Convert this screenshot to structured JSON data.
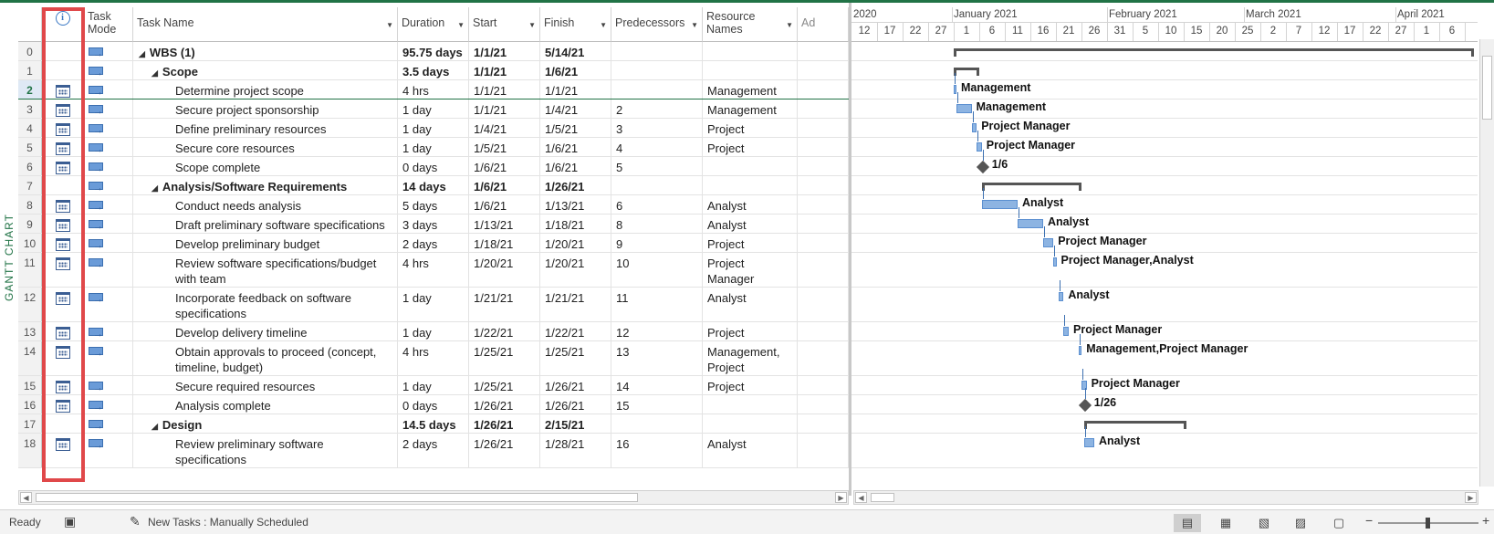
{
  "view_label": "GANTT CHART",
  "columns": {
    "info_icon": "info-icon",
    "task_mode": "Task\nMode",
    "task_name": "Task Name",
    "duration": "Duration",
    "start": "Start",
    "finish": "Finish",
    "predecessors": "Predecessors",
    "resource_names": "Resource\nNames",
    "add": "Ad"
  },
  "rows": [
    {
      "id": "0",
      "indent": 0,
      "summary": true,
      "name": "WBS (1)",
      "duration": "95.75 days",
      "start": "1/1/21",
      "finish": "5/14/21",
      "pred": "",
      "res": "",
      "cal": false
    },
    {
      "id": "1",
      "indent": 1,
      "summary": true,
      "name": "Scope",
      "duration": "3.5 days",
      "start": "1/1/21",
      "finish": "1/6/21",
      "pred": "",
      "res": "",
      "cal": false
    },
    {
      "id": "2",
      "indent": 2,
      "summary": false,
      "name": "Determine project scope",
      "duration": "4 hrs",
      "start": "1/1/21",
      "finish": "1/1/21",
      "pred": "",
      "res": "Management",
      "cal": true,
      "selected": true
    },
    {
      "id": "3",
      "indent": 2,
      "summary": false,
      "name": "Secure project sponsorship",
      "duration": "1 day",
      "start": "1/1/21",
      "finish": "1/4/21",
      "pred": "2",
      "res": "Management",
      "cal": true
    },
    {
      "id": "4",
      "indent": 2,
      "summary": false,
      "name": "Define preliminary resources",
      "duration": "1 day",
      "start": "1/4/21",
      "finish": "1/5/21",
      "pred": "3",
      "res": "Project Manager",
      "cal": true
    },
    {
      "id": "5",
      "indent": 2,
      "summary": false,
      "name": "Secure core resources",
      "duration": "1 day",
      "start": "1/5/21",
      "finish": "1/6/21",
      "pred": "4",
      "res": "Project Manager",
      "cal": true
    },
    {
      "id": "6",
      "indent": 2,
      "summary": false,
      "name": "Scope complete",
      "duration": "0 days",
      "start": "1/6/21",
      "finish": "1/6/21",
      "pred": "5",
      "res": "",
      "cal": true
    },
    {
      "id": "7",
      "indent": 1,
      "summary": true,
      "name": "Analysis/Software Requirements",
      "duration": "14 days",
      "start": "1/6/21",
      "finish": "1/26/21",
      "pred": "",
      "res": "",
      "cal": false
    },
    {
      "id": "8",
      "indent": 2,
      "summary": false,
      "name": "Conduct needs analysis",
      "duration": "5 days",
      "start": "1/6/21",
      "finish": "1/13/21",
      "pred": "6",
      "res": "Analyst",
      "cal": true
    },
    {
      "id": "9",
      "indent": 2,
      "summary": false,
      "name": "Draft preliminary software specifications",
      "duration": "3 days",
      "start": "1/13/21",
      "finish": "1/18/21",
      "pred": "8",
      "res": "Analyst",
      "cal": true
    },
    {
      "id": "10",
      "indent": 2,
      "summary": false,
      "name": "Develop preliminary budget",
      "duration": "2 days",
      "start": "1/18/21",
      "finish": "1/20/21",
      "pred": "9",
      "res": "Project Manager",
      "cal": true
    },
    {
      "id": "11",
      "indent": 2,
      "summary": false,
      "name": "Review software specifications/budget\nwith team",
      "duration": "4 hrs",
      "start": "1/20/21",
      "finish": "1/20/21",
      "pred": "10",
      "res": "Project\nManager",
      "cal": true,
      "tall": true
    },
    {
      "id": "12",
      "indent": 2,
      "summary": false,
      "name": "Incorporate feedback on software\nspecifications",
      "duration": "1 day",
      "start": "1/21/21",
      "finish": "1/21/21",
      "pred": "11",
      "res": "Analyst",
      "cal": true,
      "tall": true
    },
    {
      "id": "13",
      "indent": 2,
      "summary": false,
      "name": "Develop delivery timeline",
      "duration": "1 day",
      "start": "1/22/21",
      "finish": "1/22/21",
      "pred": "12",
      "res": "Project Manager",
      "cal": true
    },
    {
      "id": "14",
      "indent": 2,
      "summary": false,
      "name": "Obtain approvals to proceed (concept,\ntimeline, budget)",
      "duration": "4 hrs",
      "start": "1/25/21",
      "finish": "1/25/21",
      "pred": "13",
      "res": "Management,\nProject",
      "cal": true,
      "tall": true
    },
    {
      "id": "15",
      "indent": 2,
      "summary": false,
      "name": "Secure required resources",
      "duration": "1 day",
      "start": "1/25/21",
      "finish": "1/26/21",
      "pred": "14",
      "res": "Project Manager",
      "cal": true
    },
    {
      "id": "16",
      "indent": 2,
      "summary": false,
      "name": "Analysis complete",
      "duration": "0 days",
      "start": "1/26/21",
      "finish": "1/26/21",
      "pred": "15",
      "res": "",
      "cal": true
    },
    {
      "id": "17",
      "indent": 1,
      "summary": true,
      "name": "Design",
      "duration": "14.5 days",
      "start": "1/26/21",
      "finish": "2/15/21",
      "pred": "",
      "res": "",
      "cal": false
    },
    {
      "id": "18",
      "indent": 2,
      "summary": false,
      "name": "Review preliminary software\nspecifications",
      "duration": "2 days",
      "start": "1/26/21",
      "finish": "1/28/21",
      "pred": "16",
      "res": "Analyst",
      "cal": true,
      "tall": true
    }
  ],
  "timeline": {
    "top": [
      {
        "label": "2020"
      },
      {
        "label": "January 2021"
      },
      {
        "label": "February 2021"
      },
      {
        "label": "March 2021"
      },
      {
        "label": "April 2021"
      }
    ],
    "ticks": [
      "12",
      "17",
      "22",
      "27",
      "1",
      "6",
      "11",
      "16",
      "21",
      "26",
      "31",
      "5",
      "10",
      "15",
      "20",
      "25",
      "2",
      "7",
      "12",
      "17",
      "22",
      "27",
      "1",
      "6"
    ]
  },
  "gantt_labels": {
    "r2": "Management",
    "r3": "Management",
    "r4": "Project Manager",
    "r5": "Project Manager",
    "r6": "1/6",
    "r8": "Analyst",
    "r9": "Analyst",
    "r10": "Project Manager",
    "r11": "Project Manager,Analyst",
    "r12": "Analyst",
    "r13": "Project Manager",
    "r14": "Management,Project Manager",
    "r15": "Project Manager",
    "r16": "1/26",
    "r18": "Analyst"
  },
  "status": {
    "ready": "Ready",
    "new_tasks": "New Tasks : Manually Scheduled"
  },
  "colors": {
    "accent": "#217346",
    "highlight": "#e0484a",
    "bar": "#8db4e2"
  }
}
